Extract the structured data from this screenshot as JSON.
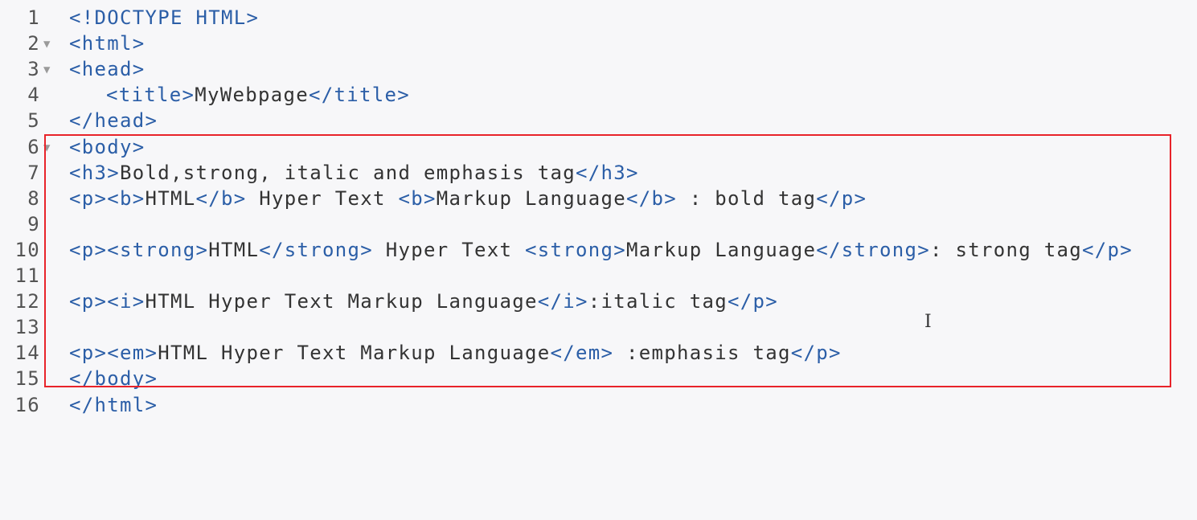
{
  "editor": {
    "lines": [
      {
        "num": "1",
        "fold": "",
        "segments": [
          {
            "t": "tag",
            "v": "<!DOCTYPE HTML>"
          }
        ]
      },
      {
        "num": "2",
        "fold": "▼",
        "segments": [
          {
            "t": "tag",
            "v": "<html>"
          }
        ]
      },
      {
        "num": "3",
        "fold": "▼",
        "segments": [
          {
            "t": "tag",
            "v": "<head>"
          }
        ]
      },
      {
        "num": "4",
        "fold": "",
        "indent": true,
        "segments": [
          {
            "t": "tag",
            "v": "<title>"
          },
          {
            "t": "txt",
            "v": "MyWebpage"
          },
          {
            "t": "tag",
            "v": "</title>"
          }
        ]
      },
      {
        "num": "5",
        "fold": "",
        "segments": [
          {
            "t": "tag",
            "v": "</head>"
          }
        ]
      },
      {
        "num": "6",
        "fold": "▼",
        "segments": [
          {
            "t": "tag",
            "v": "<body>"
          }
        ]
      },
      {
        "num": "7",
        "fold": "",
        "segments": [
          {
            "t": "tag",
            "v": "<h3>"
          },
          {
            "t": "txt",
            "v": "Bold,strong, italic and emphasis tag"
          },
          {
            "t": "tag",
            "v": "</h3>"
          }
        ]
      },
      {
        "num": "8",
        "fold": "",
        "segments": [
          {
            "t": "tag",
            "v": "<p><b>"
          },
          {
            "t": "txt",
            "v": "HTML"
          },
          {
            "t": "tag",
            "v": "</b>"
          },
          {
            "t": "txt",
            "v": " Hyper Text "
          },
          {
            "t": "tag",
            "v": "<b>"
          },
          {
            "t": "txt",
            "v": "Markup Language"
          },
          {
            "t": "tag",
            "v": "</b>"
          },
          {
            "t": "txt",
            "v": " : bold tag"
          },
          {
            "t": "tag",
            "v": "</p>"
          }
        ]
      },
      {
        "num": "9",
        "fold": "",
        "segments": []
      },
      {
        "num": "10",
        "fold": "",
        "segments": [
          {
            "t": "tag",
            "v": "<p><strong>"
          },
          {
            "t": "txt",
            "v": "HTML"
          },
          {
            "t": "tag",
            "v": "</strong>"
          },
          {
            "t": "txt",
            "v": " Hyper Text "
          },
          {
            "t": "tag",
            "v": "<strong>"
          },
          {
            "t": "txt",
            "v": "Markup Language"
          },
          {
            "t": "tag",
            "v": "</strong>"
          },
          {
            "t": "txt",
            "v": ": strong tag"
          },
          {
            "t": "tag",
            "v": "</p>"
          }
        ]
      },
      {
        "num": "11",
        "fold": "",
        "segments": []
      },
      {
        "num": "12",
        "fold": "",
        "segments": [
          {
            "t": "tag",
            "v": "<p><i>"
          },
          {
            "t": "txt",
            "v": "HTML Hyper Text Markup Language"
          },
          {
            "t": "tag",
            "v": "</i>"
          },
          {
            "t": "txt",
            "v": ":italic tag"
          },
          {
            "t": "tag",
            "v": "</p>"
          }
        ]
      },
      {
        "num": "13",
        "fold": "",
        "segments": []
      },
      {
        "num": "14",
        "fold": "",
        "segments": [
          {
            "t": "tag",
            "v": "<p><em>"
          },
          {
            "t": "txt",
            "v": "HTML Hyper Text Markup Language"
          },
          {
            "t": "tag",
            "v": "</em>"
          },
          {
            "t": "txt",
            "v": " :emphasis tag"
          },
          {
            "t": "tag",
            "v": "</p>"
          }
        ]
      },
      {
        "num": "15",
        "fold": "",
        "segments": [
          {
            "t": "tag",
            "v": "</body>"
          }
        ]
      },
      {
        "num": "16",
        "fold": "",
        "segments": [
          {
            "t": "tag",
            "v": "</html>"
          }
        ]
      }
    ],
    "cursor_icon": "text-cursor-icon",
    "colors": {
      "tag": "#2b5ea7",
      "text": "#333333",
      "highlight_border": "#e8232a",
      "background": "#f7f7f9"
    }
  }
}
